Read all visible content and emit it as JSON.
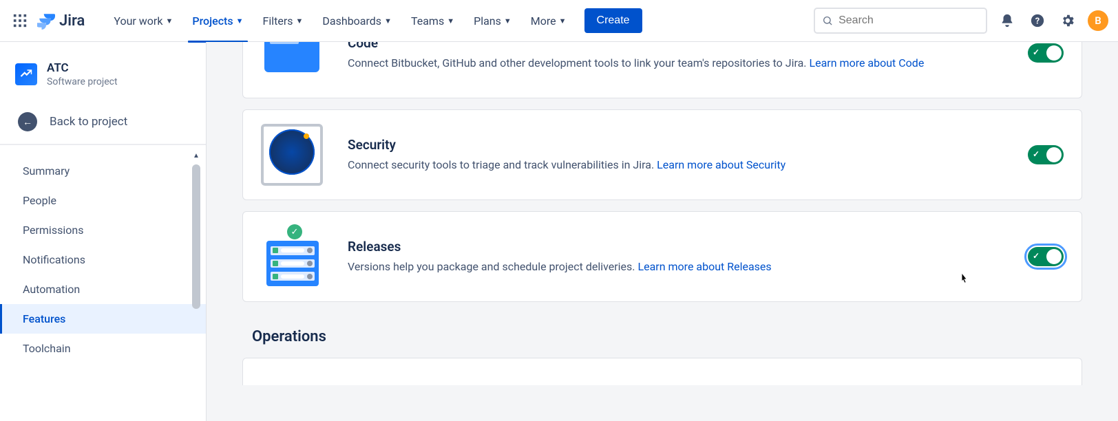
{
  "nav": {
    "product": "Jira",
    "items": [
      "Your work",
      "Projects",
      "Filters",
      "Dashboards",
      "Teams",
      "Plans",
      "More"
    ],
    "active_index": 1,
    "create": "Create",
    "search_placeholder": "Search",
    "avatar_initial": "B"
  },
  "sidebar": {
    "project_name": "ATC",
    "project_type": "Software project",
    "back": "Back to project",
    "items": [
      "Summary",
      "People",
      "Permissions",
      "Notifications",
      "Automation",
      "Features",
      "Toolchain"
    ],
    "selected_index": 5
  },
  "features": {
    "code": {
      "title": "Code",
      "desc": "Connect Bitbucket, GitHub and other development tools to link your team's repositories to Jira.",
      "link": "Learn more about Code",
      "enabled": true
    },
    "security": {
      "title": "Security",
      "desc": "Connect security tools to triage and track vulnerabilities in Jira.",
      "link": "Learn more about Security",
      "enabled": true
    },
    "releases": {
      "title": "Releases",
      "desc": "Versions help you package and schedule project deliveries.",
      "link": "Learn more about Releases",
      "enabled": true
    }
  },
  "sections": {
    "operations": "Operations"
  }
}
